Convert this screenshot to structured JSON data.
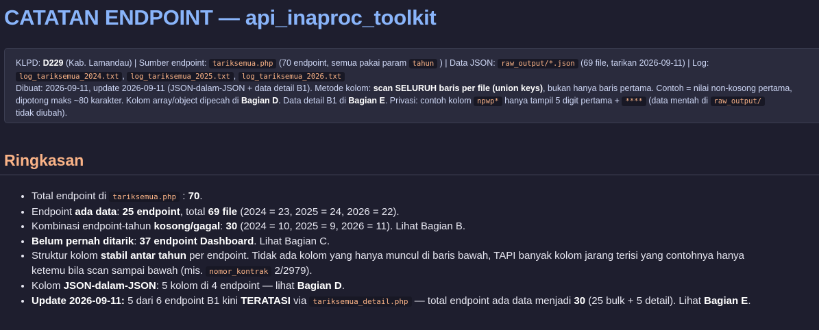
{
  "title": "CATATAN ENDPOINT — api_inaproc_toolkit",
  "info": {
    "l1_klpd_label": "KLPD: ",
    "l1_klpd_code": "D229",
    "l1_klpd_name": " (Kab. Lamandau)  |  Sumber endpoint: ",
    "l1_source_file": "tariksemua.php",
    "l1_source_desc": " (70 endpoint, semua pakai param ",
    "l1_param": "tahun",
    "l1_json_label": " )  |  Data JSON: ",
    "l1_json_path": "raw_output/*.json",
    "l1_json_desc": " (69 file, tarikan 2026-09-11)  |  Log:",
    "logs": [
      "log_tariksemua_2024.txt",
      "log_tariksemua_2025.txt",
      "log_tariksemua_2026.txt"
    ],
    "log_sep": ", ",
    "l3_a": "Dibuat: 2026-09-11, update 2026-09-11 (JSON-dalam-JSON + data detail B1). Metode kolom: ",
    "l3_b": "scan SELURUH baris per file (union keys)",
    "l3_c": ", bukan hanya baris pertama. Contoh = nilai non-kosong pertama,",
    "l4_a": "dipotong maks ~80 karakter. Kolom array/object dipecah di ",
    "l4_b": "Bagian D",
    "l4_c": ". Data detail B1 di ",
    "l4_d": "Bagian E",
    "l4_e": ". Privasi: contoh kolom ",
    "l4_npwp": "npwp*",
    "l4_f": " hanya tampil 5 digit pertama + ",
    "l4_mask": "****",
    "l4_g": " (data mentah di ",
    "l4_raw": "raw_output/",
    "l5": "tidak diubah)."
  },
  "section_title": "Ringkasan",
  "summary": {
    "i1_a": "Total endpoint di ",
    "i1_code": "tariksemua.php",
    "i1_b": " : ",
    "i1_c": "70",
    "i1_d": ".",
    "i2_a": "Endpoint ",
    "i2_b": "ada data",
    "i2_c": ": ",
    "i2_d": "25 endpoint",
    "i2_e": ", total ",
    "i2_f": "69 file",
    "i2_g": " (2024 = 23, 2025 = 24, 2026 = 22).",
    "i3_a": "Kombinasi endpoint-tahun ",
    "i3_b": "kosong/gagal",
    "i3_c": ": ",
    "i3_d": "30",
    "i3_e": " (2024 = 10, 2025 = 9, 2026 = 11). Lihat Bagian B.",
    "i4_a": "Belum pernah ditarik",
    "i4_b": ": ",
    "i4_c": "37 endpoint Dashboard",
    "i4_d": ". Lihat Bagian C.",
    "i5_a": "Struktur kolom ",
    "i5_b": "stabil antar tahun",
    "i5_c": " per endpoint. Tidak ada kolom yang hanya muncul di baris bawah, TAPI banyak kolom jarang terisi yang contohnya hanya",
    "i5_d": "ketemu bila scan sampai bawah (mis. ",
    "i5_code": "nomor_kontrak",
    "i5_e": " 2/2979).",
    "i6_a": "Kolom ",
    "i6_b": "JSON-dalam-JSON",
    "i6_c": ": 5 kolom di 4 endpoint — lihat ",
    "i6_d": "Bagian D",
    "i6_e": ".",
    "i7_a": "Update 2026-09-11:",
    "i7_b": " 5 dari 6 endpoint B1 kini ",
    "i7_c": "TERATASI",
    "i7_d": " via ",
    "i7_code": "tariksemua_detail.php",
    "i7_e": " — total endpoint ada data menjadi ",
    "i7_f": "30",
    "i7_g": " (25 bulk + 5 detail). Lihat ",
    "i7_h": "Bagian E",
    "i7_i": "."
  }
}
